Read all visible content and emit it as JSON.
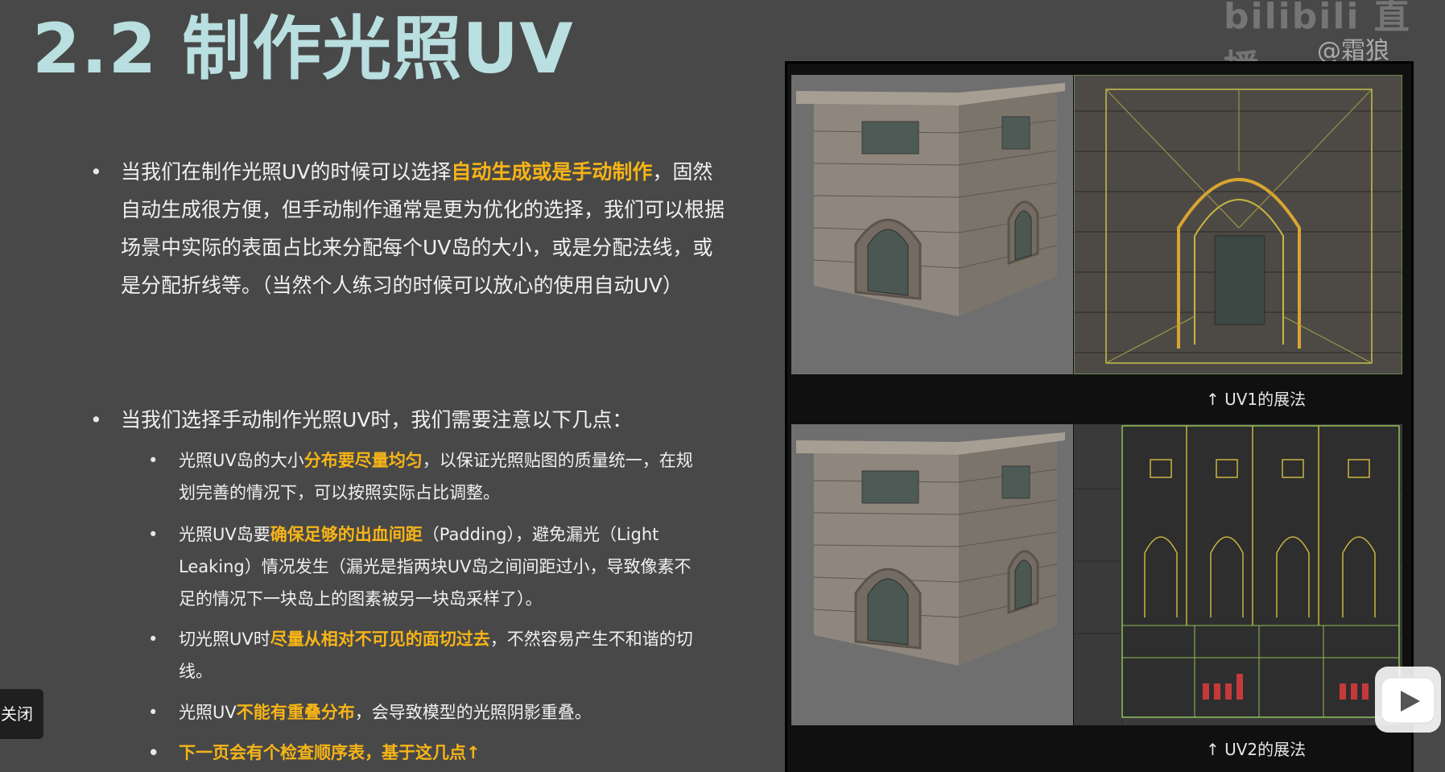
{
  "title": "2.2 制作光照UV",
  "watermark": {
    "logo": "bilibili 直播",
    "user": "@霜狼_may"
  },
  "bullets": [
    {
      "parts": [
        {
          "text": "当我们在制作光照UV的时候可以选择",
          "hl": false
        },
        {
          "text": "自动生成或是手动制作",
          "hl": true
        },
        {
          "text": "，固然自动生成很方便，但手动制作通常是更为优化的选择，我们可以根据场景中实际的表面占比来分配每个UV岛的大小，或是分配法线，或是分配折线等。（当然个人练习的时候可以放心的使用自动UV）",
          "hl": false
        }
      ]
    },
    {
      "parts": [
        {
          "text": "当我们选择手动制作光照UV时，我们需要注意以下几点：",
          "hl": false
        }
      ]
    }
  ],
  "sub_bullets": [
    {
      "parts": [
        {
          "text": "光照UV岛的大小",
          "hl": false
        },
        {
          "text": "分布要尽量均匀",
          "hl": true
        },
        {
          "text": "，以保证光照贴图的质量统一，在规划完善的情况下，可以按照实际占比调整。",
          "hl": false
        }
      ]
    },
    {
      "parts": [
        {
          "text": "光照UV岛要",
          "hl": false
        },
        {
          "text": "确保足够的出血间距",
          "hl": true
        },
        {
          "text": "（Padding），避免漏光（Light Leaking）情况发生（漏光是指两块UV岛之间间距过小，导致像素不足的情况下一块岛上的图素被另一块岛采样了）。",
          "hl": false
        }
      ]
    },
    {
      "parts": [
        {
          "text": "切光照UV时",
          "hl": false
        },
        {
          "text": "尽量从相对不可见的面切过去",
          "hl": true
        },
        {
          "text": "，不然容易产生不和谐的切线。",
          "hl": false
        }
      ]
    },
    {
      "parts": [
        {
          "text": "光照UV",
          "hl": false
        },
        {
          "text": "不能有重叠分布",
          "hl": true
        },
        {
          "text": "，会导致模型的光照阴影重叠。",
          "hl": false
        }
      ]
    },
    {
      "parts": [
        {
          "text": "下一页会有个检查顺序表，基于这几点↑",
          "hl": true
        }
      ]
    }
  ],
  "captions": {
    "uv1": "↑ UV1的展法",
    "uv2": "↑ UV2的展法"
  },
  "close_label": "关闭",
  "colors": {
    "background": "#484848",
    "title": "#b9dfe0",
    "highlight": "#f6b417"
  }
}
